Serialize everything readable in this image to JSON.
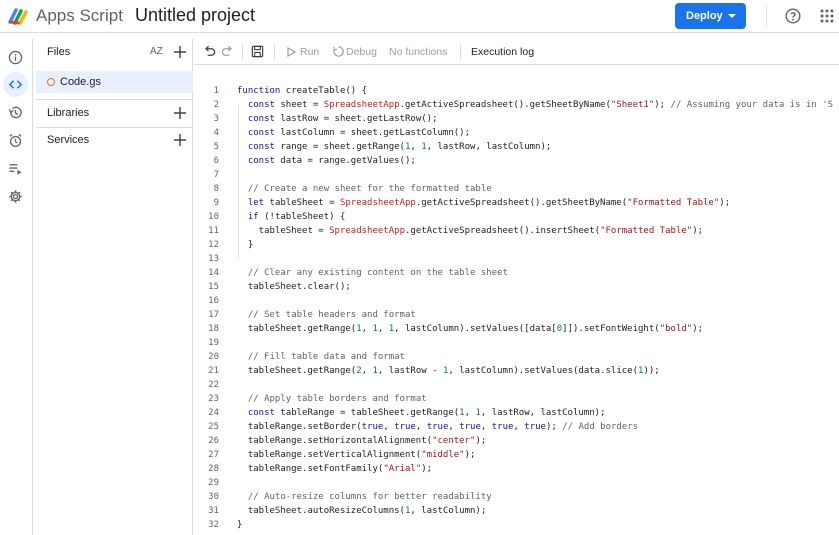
{
  "header": {
    "app_name": "Apps Script",
    "project_title": "Untitled project",
    "deploy_label": "Deploy"
  },
  "rail": {
    "icons": [
      "info-icon",
      "code-icon",
      "history-icon",
      "alarm-icon",
      "executions-icon",
      "settings-icon"
    ]
  },
  "files_panel": {
    "files_label": "Files",
    "sort_label": "AZ",
    "file_name": "Code.gs",
    "libraries_label": "Libraries",
    "services_label": "Services"
  },
  "toolbar": {
    "run_label": "Run",
    "debug_label": "Debug",
    "function_label": "No functions",
    "execution_log_label": "Execution log"
  },
  "code_lines": [
    "function createTable() {",
    "  const sheet = SpreadsheetApp.getActiveSpreadsheet().getSheetByName(\"Sheet1\"); // Assuming your data is in 'S",
    "  const lastRow = sheet.getLastRow();",
    "  const lastColumn = sheet.getLastColumn();",
    "  const range = sheet.getRange(1, 1, lastRow, lastColumn);",
    "  const data = range.getValues();",
    "",
    "  // Create a new sheet for the formatted table",
    "  let tableSheet = SpreadsheetApp.getActiveSpreadsheet().getSheetByName(\"Formatted Table\");",
    "  if (!tableSheet) {",
    "    tableSheet = SpreadsheetApp.getActiveSpreadsheet().insertSheet(\"Formatted Table\");",
    "  }",
    "",
    "  // Clear any existing content on the table sheet",
    "  tableSheet.clear();",
    "",
    "  // Set table headers and format",
    "  tableSheet.getRange(1, 1, 1, lastColumn).setValues([data[0]]).setFontWeight(\"bold\");",
    "",
    "  // Fill table data and format",
    "  tableSheet.getRange(2, 1, lastRow - 1, lastColumn).setValues(data.slice(1));",
    "",
    "  // Apply table borders and format",
    "  const tableRange = tableSheet.getRange(1, 1, lastRow, lastColumn);",
    "  tableRange.setBorder(true, true, true, true, true, true); // Add borders",
    "  tableRange.setHorizontalAlignment(\"center\");",
    "  tableRange.setVerticalAlignment(\"middle\");",
    "  tableRange.setFontFamily(\"Arial\");",
    "",
    "  // Auto-resize columns for better readability",
    "  tableSheet.autoResizeColumns(1, lastColumn);",
    "}"
  ],
  "colors": {
    "accent": "#1a73e8",
    "keyword": "#1a0dab",
    "string": "#a31515",
    "comment": "#5f6368",
    "class": "#c5221f",
    "number": "#0b8043"
  }
}
